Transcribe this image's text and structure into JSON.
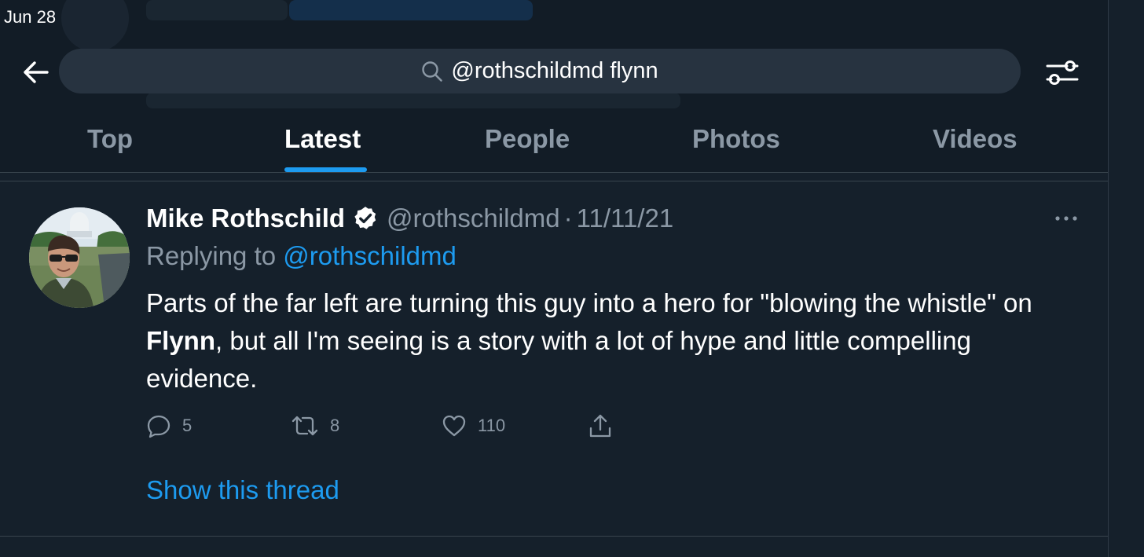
{
  "status_bar": {
    "time": "Jun 28"
  },
  "search": {
    "query": "@rothschildmd flynn"
  },
  "tabs": [
    {
      "label": "Top",
      "active": false
    },
    {
      "label": "Latest",
      "active": true
    },
    {
      "label": "People",
      "active": false
    },
    {
      "label": "Photos",
      "active": false
    },
    {
      "label": "Videos",
      "active": false
    }
  ],
  "tweet": {
    "display_name": "Mike Rothschild",
    "verified": true,
    "handle": "@rothschildmd",
    "separator": "·",
    "date": "11/11/21",
    "replying_prefix": "Replying to ",
    "replying_to": "@rothschildmd",
    "text_before": "Parts of the far left are turning this guy into a hero for \"blowing the whistle\" on ",
    "text_bold": "Flynn",
    "text_after": ", but all I'm seeing is a story with a lot of hype and little compelling evidence.",
    "reply_count": "5",
    "retweet_count": "8",
    "like_count": "110",
    "show_thread_label": "Show this thread"
  },
  "colors": {
    "background": "#15202b",
    "header_background": "#121c26",
    "accent": "#1d9bf0",
    "secondary_text": "#8b98a5",
    "search_fill": "#273340",
    "divider": "#38444d"
  },
  "icons": {
    "back": "arrow-left-icon",
    "search": "magnifier-icon",
    "filter": "sliders-icon",
    "verified": "verified-badge-icon",
    "more": "ellipsis-icon",
    "reply": "speech-bubble-icon",
    "retweet": "retweet-arrows-icon",
    "like": "heart-icon",
    "share": "share-upload-icon"
  }
}
